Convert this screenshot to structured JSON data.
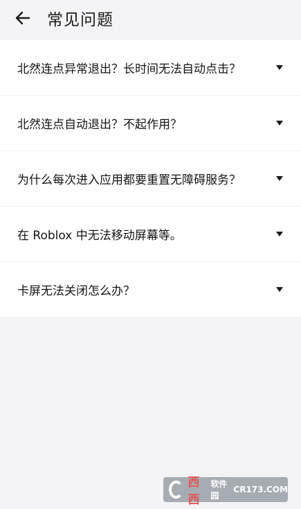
{
  "header": {
    "title": "常见问题",
    "back_icon": "arrow-left-icon"
  },
  "faq": {
    "items": [
      {
        "question": "北然连点异常退出？长时间无法自动点击？"
      },
      {
        "question": "北然连点自动退出？不起作用？"
      },
      {
        "question": "为什么每次进入应用都要重置无障碍服务？"
      },
      {
        "question": "在 Roblox 中无法移动屏幕等。"
      },
      {
        "question": "卡屏无法关闭怎么办？"
      }
    ],
    "expand_icon": "caret-down-icon"
  },
  "watermark": {
    "brand": "西西",
    "site": "软件园",
    "url": "CR173.COM"
  }
}
